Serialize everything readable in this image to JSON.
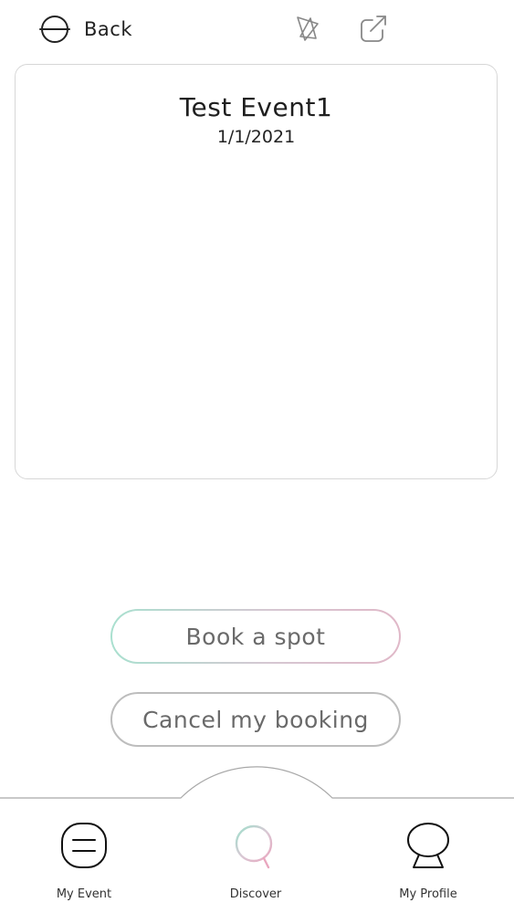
{
  "header": {
    "back_label": "Back",
    "icons": [
      "back-icon",
      "favorite-icon",
      "share-icon"
    ]
  },
  "event": {
    "title": "Test Event1",
    "date": "1/1/2021"
  },
  "actions": {
    "book_label": "Book a spot",
    "cancel_label": "Cancel my booking"
  },
  "nav": {
    "items": [
      {
        "label": "My Event",
        "icon": "my-event-icon"
      },
      {
        "label": "Discover",
        "icon": "discover-icon"
      },
      {
        "label": "My Profile",
        "icon": "my-profile-icon"
      }
    ]
  },
  "colors": {
    "book_border_start": "#a9e0cf",
    "book_border_end": "#e0b8c8",
    "cancel_border": "#bdbdbd",
    "card_border": "#d7d7d7"
  }
}
